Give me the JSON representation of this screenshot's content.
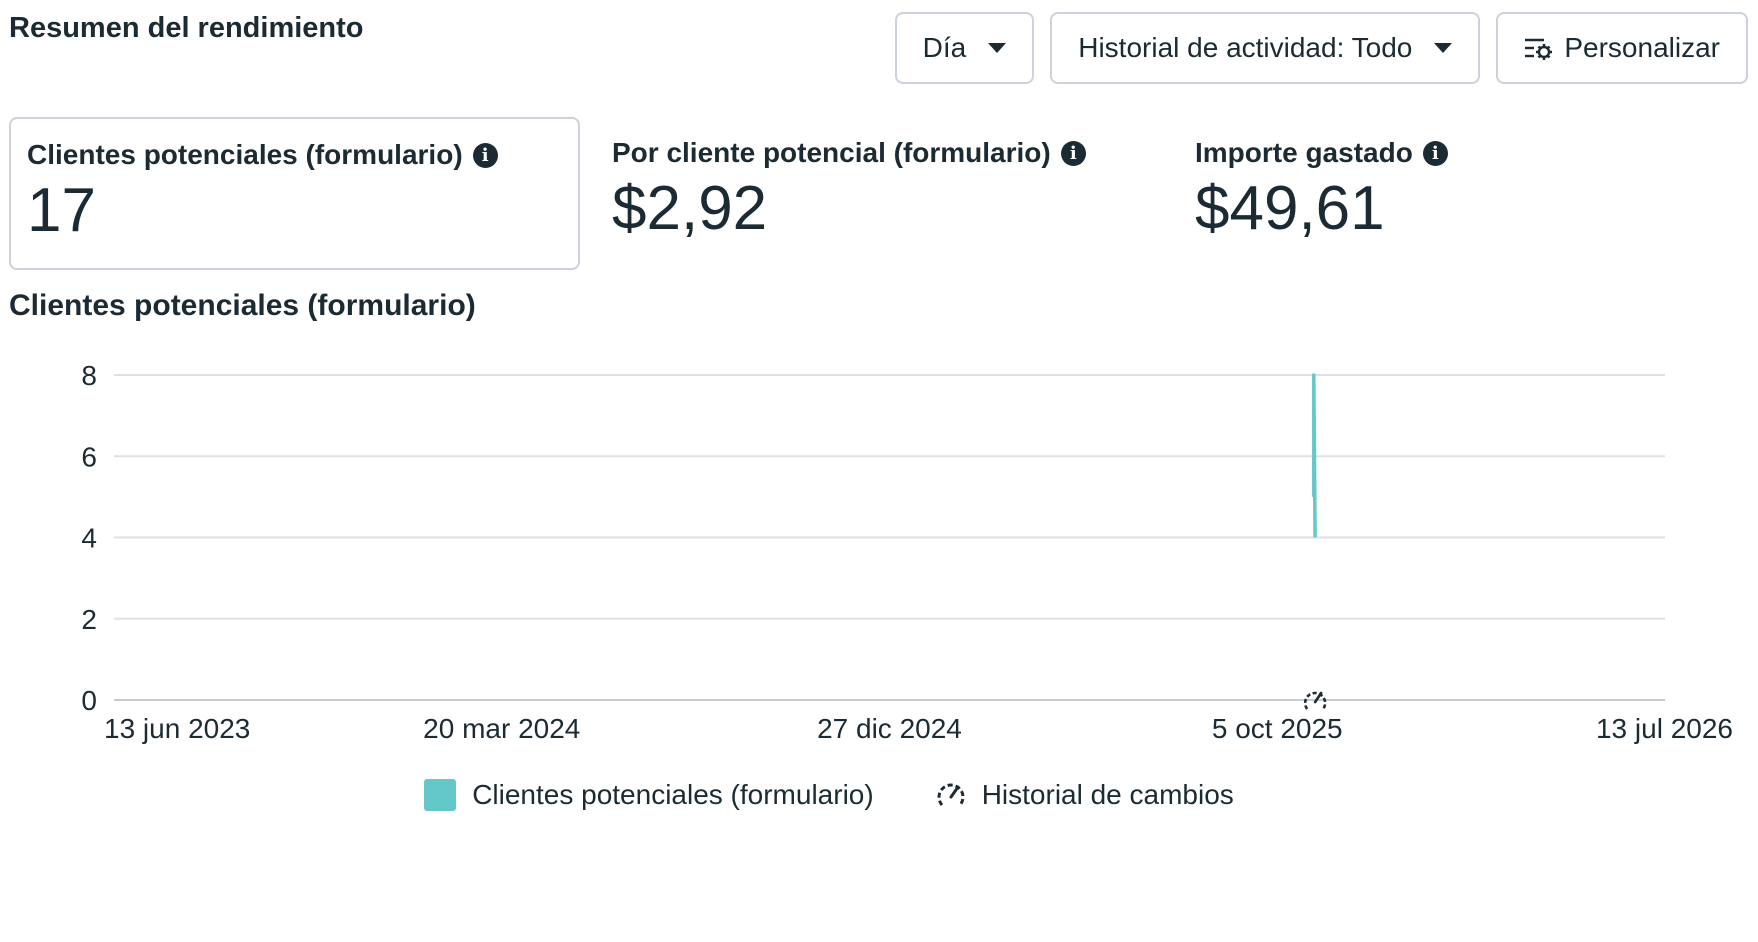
{
  "header": {
    "title": "Resumen del rendimiento",
    "day_button": "Día",
    "activity_button": "Historial de actividad: Todo",
    "customize_button": "Personalizar"
  },
  "metrics": [
    {
      "label": "Clientes potenciales (formulario)",
      "value": "17",
      "selected": true
    },
    {
      "label": "Por cliente potencial (formulario)",
      "value": "$2,92",
      "selected": false
    },
    {
      "label": "Importe gastado",
      "value": "$49,61",
      "selected": false
    }
  ],
  "info_glyph": "i",
  "chart_data": {
    "type": "line",
    "title": "Clientes potenciales (formulario)",
    "x_ticks": [
      "13 jun 2023",
      "20 mar 2024",
      "27 dic 2024",
      "5 oct 2025",
      "13 jul 2026"
    ],
    "x_range": [
      "2023-06-13",
      "2026-07-13"
    ],
    "ylim": [
      0,
      8
    ],
    "y_ticks": [
      0,
      2,
      4,
      6,
      8
    ],
    "grid": true,
    "series": [
      {
        "name": "Clientes potenciales (formulario)",
        "color": "#64c8c8",
        "points": [
          {
            "x": "2025-10-31",
            "y": 5
          },
          {
            "x": "2025-10-31",
            "y": 8
          },
          {
            "x": "2025-11-01",
            "y": 4
          }
        ]
      }
    ],
    "change_markers": [
      {
        "x": "2025-11-01"
      }
    ],
    "legend": [
      {
        "label": "Clientes potenciales (formulario)",
        "kind": "swatch",
        "color": "#64c8c8"
      },
      {
        "label": "Historial de cambios",
        "kind": "change-history-icon"
      }
    ],
    "legend_position": "bottom"
  }
}
